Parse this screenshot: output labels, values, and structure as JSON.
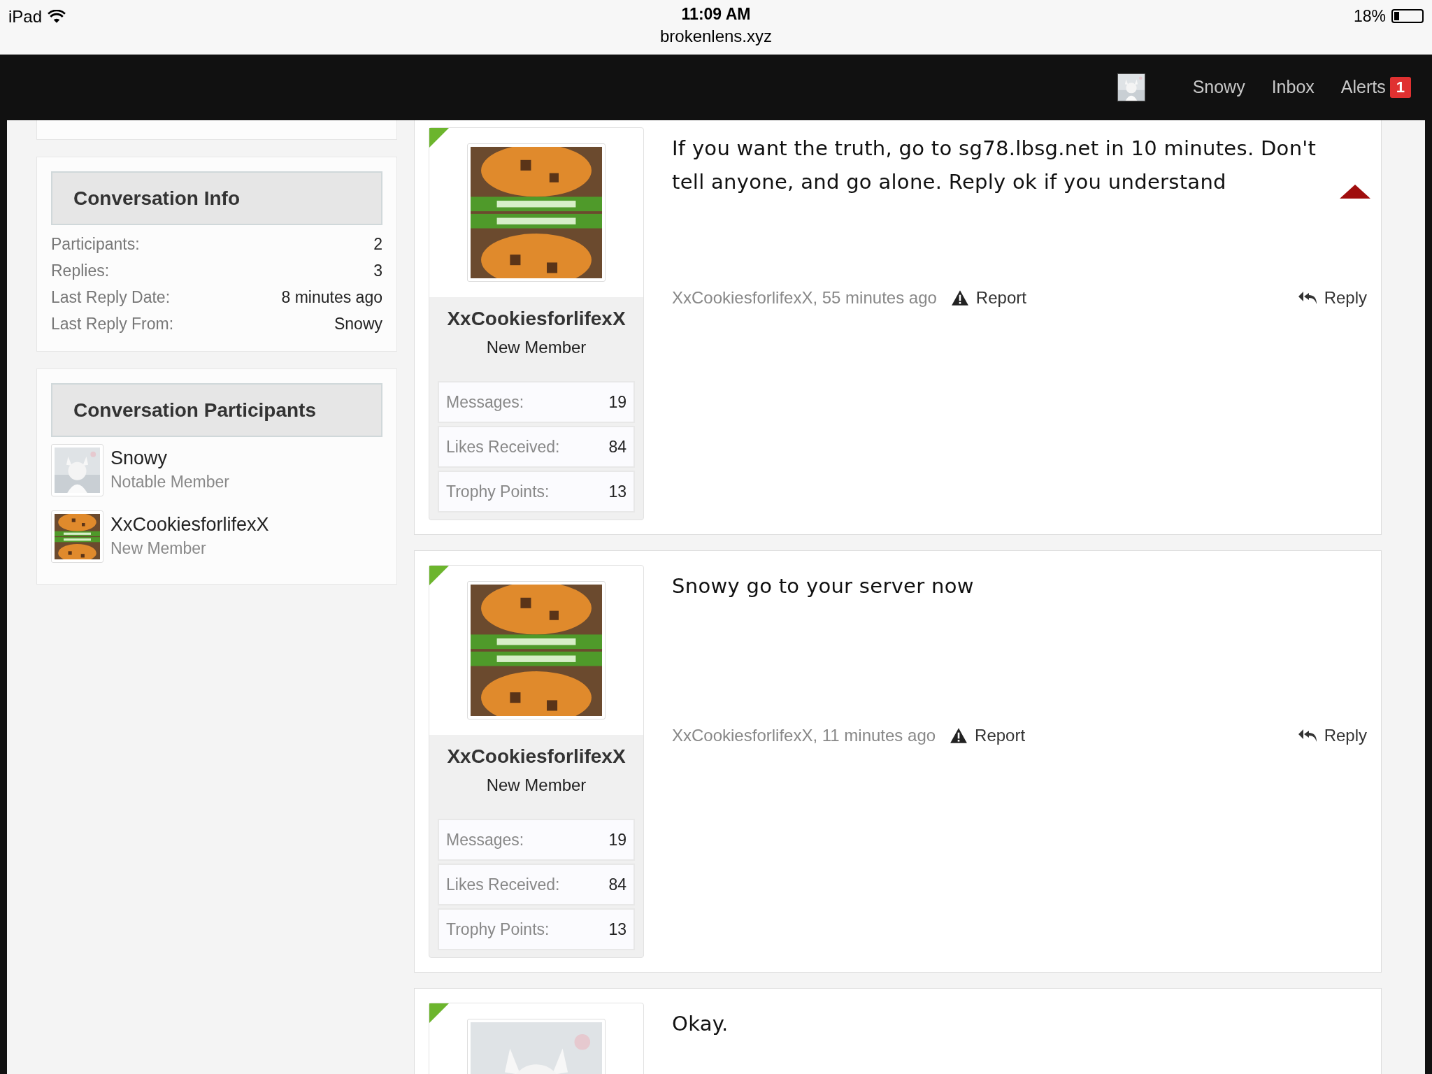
{
  "status_bar": {
    "device": "iPad",
    "time": "11:09 AM",
    "url": "brokenlens.xyz",
    "battery": "18%"
  },
  "nav": {
    "items": [
      {
        "kind": "user",
        "label": "Snowy"
      },
      {
        "kind": "link",
        "label": "Inbox"
      },
      {
        "kind": "alerts",
        "label": "Alerts",
        "badge": "1"
      }
    ]
  },
  "sidebar": {
    "conversation_info": {
      "title": "Conversation Info",
      "rows": [
        {
          "label": "Participants:",
          "value": "2"
        },
        {
          "label": "Replies:",
          "value": "3"
        },
        {
          "label": "Last Reply Date:",
          "value": "8 minutes ago"
        },
        {
          "label": "Last Reply From:",
          "value": "Snowy"
        }
      ]
    },
    "participants": {
      "title": "Conversation Participants",
      "members": [
        {
          "name": "Snowy",
          "rank": "Notable Member"
        },
        {
          "name": "XxCookiesforlifexX",
          "rank": "New Member"
        }
      ]
    }
  },
  "posts": [
    {
      "author": "XxCookiesforlifexX",
      "rank": "New Member",
      "stats": [
        {
          "label": "Messages:",
          "value": "19"
        },
        {
          "label": "Likes Received:",
          "value": "84"
        },
        {
          "label": "Trophy Points:",
          "value": "13"
        }
      ],
      "message": "If you want the truth, go to sg78.lbsg.net in 10 minutes. Don't tell anyone, and go alone. Reply ok if you understand",
      "collapse_marker": true,
      "byline": "XxCookiesforlifexX, 55 minutes ago",
      "report": "Report",
      "reply": "Reply"
    },
    {
      "author": "XxCookiesforlifexX",
      "rank": "New Member",
      "stats": [
        {
          "label": "Messages:",
          "value": "19"
        },
        {
          "label": "Likes Received:",
          "value": "84"
        },
        {
          "label": "Trophy Points:",
          "value": "13"
        }
      ],
      "message": "Snowy go to your server now",
      "collapse_marker": false,
      "byline": "XxCookiesforlifexX, 11 minutes ago",
      "report": "Report",
      "reply": "Reply"
    },
    {
      "message": "Okay.",
      "collapse_marker": false
    }
  ]
}
